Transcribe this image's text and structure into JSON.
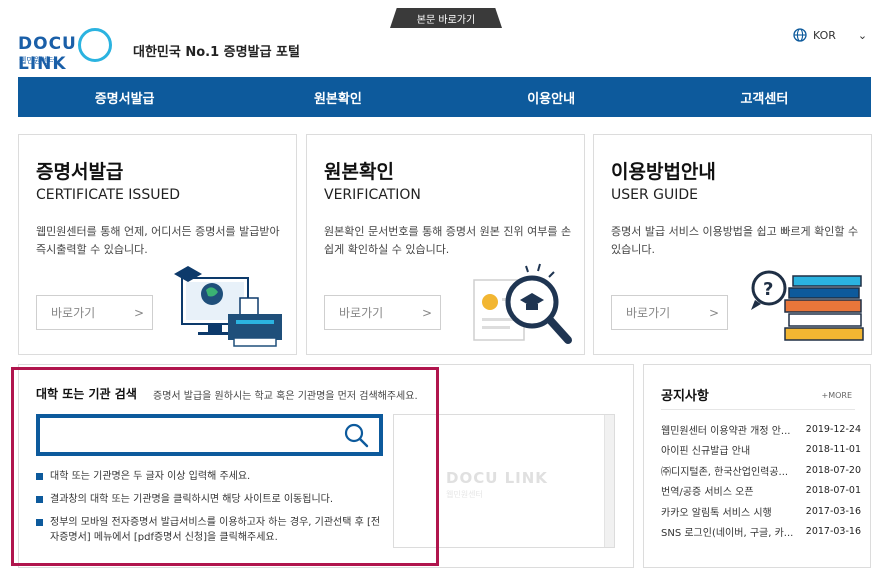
{
  "skip_link": "본문 바로가기",
  "logo": {
    "word": "DOCU LINK",
    "sub": "웹민원센터"
  },
  "tagline": "대한민국 No.1 증명발급 포털",
  "language": {
    "label": "KOR"
  },
  "gnb": [
    "증명서발급",
    "원본확인",
    "이용안내",
    "고객센터"
  ],
  "cards": [
    {
      "title": "증명서발급",
      "en": "CERTIFICATE ISSUED",
      "desc": "웹민원센터를 통해 언제, 어디서든 증명서를 발급받아 즉시출력할 수 있습니다.",
      "button": "바로가기",
      "arrow": ">"
    },
    {
      "title": "원본확인",
      "en": "VERIFICATION",
      "desc": "원본확인 문서번호를 통해 증명서 원본 진위 여부를 손쉽게 확인하실 수 있습니다.",
      "button": "바로가기",
      "arrow": ">"
    },
    {
      "title": "이용방법안내",
      "en": "USER GUIDE",
      "desc": "증명서 발급 서비스 이용방법을 쉽고 빠르게 확인할 수 있습니다.",
      "button": "바로가기",
      "arrow": ">"
    }
  ],
  "search": {
    "title": "대학 또는 기관 검색",
    "hint": "증명서 발급을 원하시는 학교 혹은 기관명을 먼저 검색해주세요.",
    "value": "",
    "notes": [
      "대학 또는 기관명은 두 글자 이상 입력해 주세요.",
      "결과창의 대학 또는 기관명을 클릭하시면 해당 사이트로 이동됩니다.",
      "정부의 모바일 전자증명서 발급서비스를 이용하고자 하는 경우, 기관선택 후 [전자증명서] 메뉴에서 [pdf증명서 신청]을 클릭해주세요."
    ],
    "watermark": "DOCU LINK",
    "watermark_sub": "웹민원센터"
  },
  "notice": {
    "title": "공지사항",
    "more": "+MORE",
    "items": [
      {
        "title": "웹민원센터 이용약관 개정 안...",
        "date": "2019-12-24"
      },
      {
        "title": "아이핀 신규발급 안내",
        "date": "2018-11-01"
      },
      {
        "title": "㈜디지털존, 한국산업인력공...",
        "date": "2018-07-20"
      },
      {
        "title": "번역/공증 서비스 오픈",
        "date": "2018-07-01"
      },
      {
        "title": "카카오 알림톡 서비스 시행",
        "date": "2017-03-16"
      },
      {
        "title": "SNS 로그인(네이버, 구글, 카...",
        "date": "2017-03-16"
      }
    ]
  },
  "colors": {
    "brand": "#0d5a9c",
    "accent": "#2bb3e0",
    "highlight": "#b0154d"
  }
}
